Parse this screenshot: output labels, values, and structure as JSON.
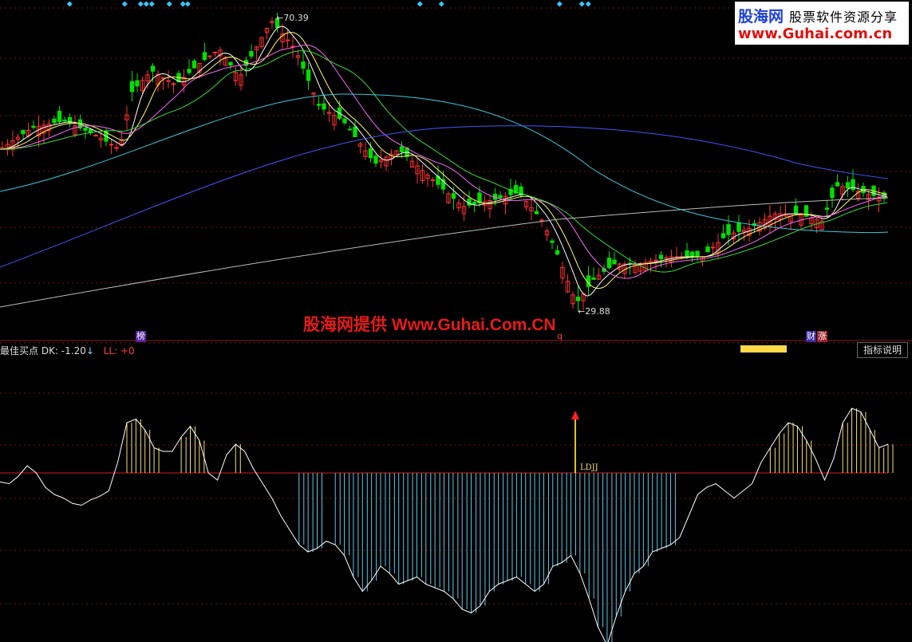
{
  "watermark": "股海网提供 Www.Guhai.Com.CN",
  "logo": {
    "brand": "股海网",
    "slogan": "股票软件资源分享",
    "url": "www.Guhai.com.cn"
  },
  "indicator_header": {
    "name": "最佳买点",
    "dk_label": "DK: -1.20",
    "dk_arrow": "↓",
    "ll_label": "LL: +0"
  },
  "help_button": "指标说明",
  "top_tags": {
    "left": "榜",
    "mid": "q",
    "right1": "财",
    "right2": "涨"
  },
  "chart_data": [
    {
      "type": "candlestick",
      "annotations": [
        {
          "text": "70.39",
          "label": "high"
        },
        {
          "text": "29.88",
          "label": "low"
        }
      ],
      "series_colors": {
        "up": "#ff3030",
        "down": "#00e000",
        "ma_short": "#ffffff",
        "ma_mid": "#ffff66",
        "ma_pink": "#ff66ff",
        "ma_green": "#33dd33",
        "ma_cyan": "#33ccdd",
        "ma_blue": "#4455ff",
        "ma_long": "#bbbbbb"
      },
      "ohlc_sample_notes": "price path from about 55 rising to 70.39 high, falling to 29.88 low, recovering to about 44",
      "high": 70.39,
      "low": 29.88
    },
    {
      "type": "line",
      "title": "最佳买点",
      "signal_label": "LDJJ",
      "zero_line": 0,
      "series": [
        {
          "values": [
            -5,
            -6,
            -2,
            4,
            0,
            -8,
            -12,
            -14,
            -17,
            -18,
            -15,
            -13,
            -10,
            6,
            28,
            30,
            24,
            14,
            12,
            12,
            20,
            26,
            18,
            0,
            -4,
            10,
            16,
            12,
            2,
            -6,
            -14,
            -24,
            -32,
            -40,
            -44,
            -42,
            -38,
            -40,
            -46,
            -58,
            -66,
            -60,
            -52,
            -56,
            -62,
            -60,
            -58,
            -62,
            -64,
            -66,
            -70,
            -76,
            -78,
            -74,
            -66,
            -62,
            -60,
            -58,
            -62,
            -66,
            -62,
            -52,
            -50,
            -46,
            -56,
            -70,
            -86,
            -96,
            -80,
            -66,
            -56,
            -52,
            -44,
            -42,
            -40,
            -36,
            -24,
            -12,
            -8,
            -6,
            -10,
            -14,
            -10,
            -6,
            6,
            14,
            22,
            28,
            26,
            18,
            8,
            -4,
            8,
            28,
            36,
            34,
            24,
            14,
            16
          ]
        }
      ]
    }
  ]
}
